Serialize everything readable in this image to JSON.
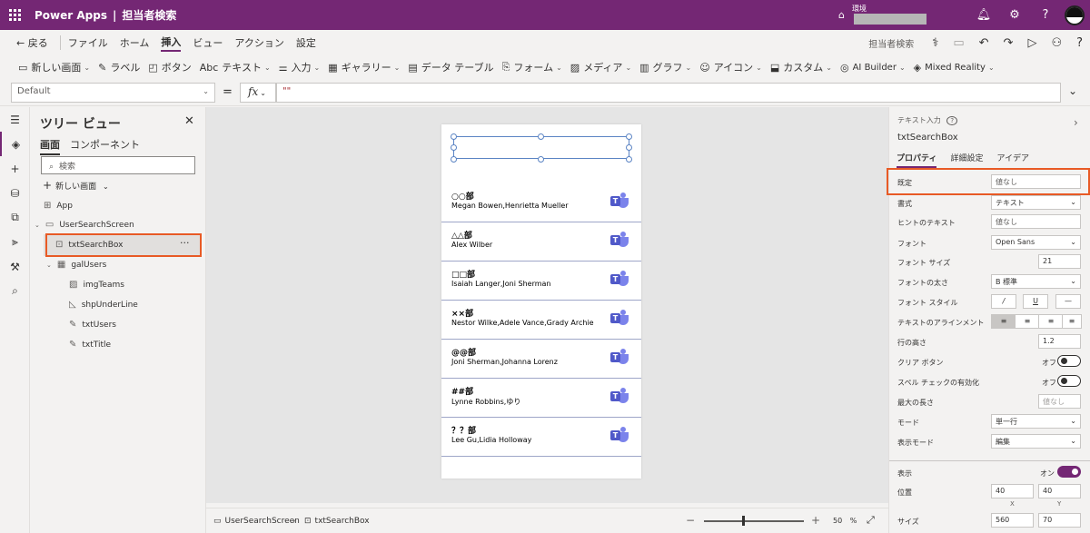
{
  "app": {
    "name": "Power Apps",
    "title_separator": "|",
    "title": "担当者検索",
    "env_label": "環境"
  },
  "menu": {
    "back": "← 戻る",
    "items": [
      "ファイル",
      "ホーム",
      "挿入",
      "ビュー",
      "アクション",
      "設定"
    ],
    "active": "挿入",
    "screen_name": "担当者検索"
  },
  "ribbon": [
    {
      "icon": "new-screen-icon",
      "glyph": "▭",
      "label": "新しい画面",
      "chevron": true
    },
    {
      "icon": "label-icon",
      "glyph": "✎",
      "label": "ラベル",
      "chevron": false
    },
    {
      "icon": "button-icon",
      "glyph": "◰",
      "label": "ボタン",
      "chevron": false
    },
    {
      "icon": "text-icon",
      "glyph": "Abc",
      "label": "テキスト",
      "chevron": true
    },
    {
      "icon": "input-icon",
      "glyph": "⚌",
      "label": "入力",
      "chevron": true
    },
    {
      "icon": "gallery-icon",
      "glyph": "▦",
      "label": "ギャラリー",
      "chevron": true
    },
    {
      "icon": "data-table-icon",
      "glyph": "▤",
      "label": "データ テーブル",
      "chevron": false
    },
    {
      "icon": "form-icon",
      "glyph": "⎘",
      "label": "フォーム",
      "chevron": true
    },
    {
      "icon": "media-icon",
      "glyph": "▨",
      "label": "メディア",
      "chevron": true
    },
    {
      "icon": "chart-icon",
      "glyph": "▥",
      "label": "グラフ",
      "chevron": true
    },
    {
      "icon": "icons-icon",
      "glyph": "☺",
      "label": "アイコン",
      "chevron": true
    },
    {
      "icon": "custom-icon",
      "glyph": "⬓",
      "label": "カスタム",
      "chevron": true
    },
    {
      "icon": "ai-builder-icon",
      "glyph": "◎",
      "label": "AI Builder",
      "chevron": true
    },
    {
      "icon": "mixed-reality-icon",
      "glyph": "◈",
      "label": "Mixed Reality",
      "chevron": true
    }
  ],
  "formula": {
    "property": "Default",
    "equals": "=",
    "fx": "fx",
    "value": "\"\""
  },
  "tree": {
    "title": "ツリー ビュー",
    "tabs": [
      "画面",
      "コンポーネント"
    ],
    "search_placeholder": "検索",
    "new_screen": "新しい画面",
    "nodes": {
      "app": "App",
      "screen": "UserSearchScreen",
      "txtSearchBox": "txtSearchBox",
      "galUsers": "galUsers",
      "imgTeams": "imgTeams",
      "shpUnderLine": "shpUnderLine",
      "txtUsers": "txtUsers",
      "txtTitle": "txtTitle"
    },
    "more": "···"
  },
  "gallery": [
    {
      "title": "○○部",
      "users": "Megan Bowen,Henrietta Mueller"
    },
    {
      "title": "△△部",
      "users": "Alex Wilber"
    },
    {
      "title": "□□部",
      "users": "Isaiah Langer,Joni Sherman"
    },
    {
      "title": "××部",
      "users": "Nestor Wilke,Adele Vance,Grady Archie"
    },
    {
      "title": "@@部",
      "users": "Joni Sherman,Johanna Lorenz"
    },
    {
      "title": "##部",
      "users": "Lynne Robbins,ゆり"
    },
    {
      "title": "？？部",
      "users": "Lee Gu,Lidia Holloway"
    }
  ],
  "status": {
    "screen": "UserSearchScreen",
    "control": "txtSearchBox",
    "zoom": "50",
    "zoom_unit": "%",
    "zoom_level": 0.38
  },
  "props": {
    "type": "テキスト入力",
    "name": "txtSearchBox",
    "tabs": [
      "プロパティ",
      "詳細設定",
      "アイデア"
    ],
    "default_label": "既定",
    "default_value": "値なし",
    "format_label": "書式",
    "format_value": "テキスト",
    "hint_label": "ヒントのテキスト",
    "hint_value": "値なし",
    "font_label": "フォント",
    "font_value": "Open Sans",
    "font_size_label": "フォント サイズ",
    "font_size_value": "21",
    "font_weight_label": "フォントの太さ",
    "font_weight_value": "B 標準",
    "font_style_label": "フォント スタイル",
    "font_style_buttons": [
      "/",
      "U",
      "—"
    ],
    "align_label": "テキストのアラインメント",
    "line_height_label": "行の高さ",
    "line_height_value": "1.2",
    "clear_label": "クリア ボタン",
    "clear_state": "オフ",
    "spell_label": "スペル チェックの有効化",
    "spell_state": "オフ",
    "maxlen_label": "最大の長さ",
    "maxlen_value": "値なし",
    "mode_label": "モード",
    "mode_value": "単一行",
    "display_label": "表示モード",
    "display_value": "編集",
    "visible_label": "表示",
    "visible_state": "オン",
    "position_label": "位置",
    "pos_x": "40",
    "pos_y": "40",
    "x_label": "X",
    "y_label": "Y",
    "size_label": "サイズ",
    "width": "560",
    "height": "70"
  }
}
